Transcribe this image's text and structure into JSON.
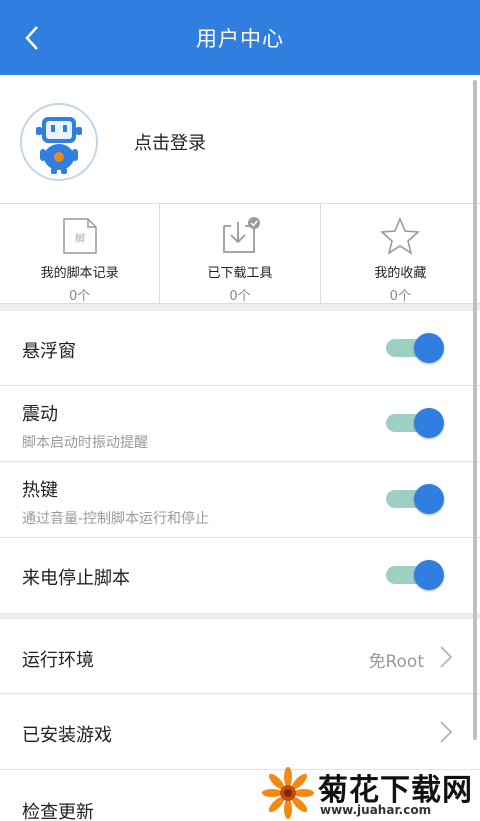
{
  "header": {
    "title": "用户中心",
    "back_icon": "chevron-left-icon"
  },
  "profile": {
    "login_text": "点击登录",
    "avatar_icon": "robot-avatar-icon"
  },
  "stats": [
    {
      "label": "我的脚本记录",
      "count": "0个",
      "icon": "script-file-icon"
    },
    {
      "label": "已下载工具",
      "count": "0个",
      "icon": "download-tray-icon"
    },
    {
      "label": "我的收藏",
      "count": "0个",
      "icon": "star-icon"
    }
  ],
  "switches": [
    {
      "label": "悬浮窗",
      "desc": "",
      "on": true
    },
    {
      "label": "震动",
      "desc": "脚本启动时振动提醒",
      "on": true
    },
    {
      "label": "热键",
      "desc": "通过音量-控制脚本运行和停止",
      "on": true
    },
    {
      "label": "来电停止脚本",
      "desc": "",
      "on": true
    }
  ],
  "nav": [
    {
      "label": "运行环境",
      "value": "免Root"
    },
    {
      "label": "已安装游戏",
      "value": ""
    },
    {
      "label": "检查更新",
      "value": ""
    }
  ],
  "watermark": {
    "title": "菊花下载网",
    "url": "www.juahar.com"
  },
  "colors": {
    "primary": "#2f7ee0",
    "toggle_track": "#9ecfc3",
    "muted": "#9a9a9a"
  }
}
